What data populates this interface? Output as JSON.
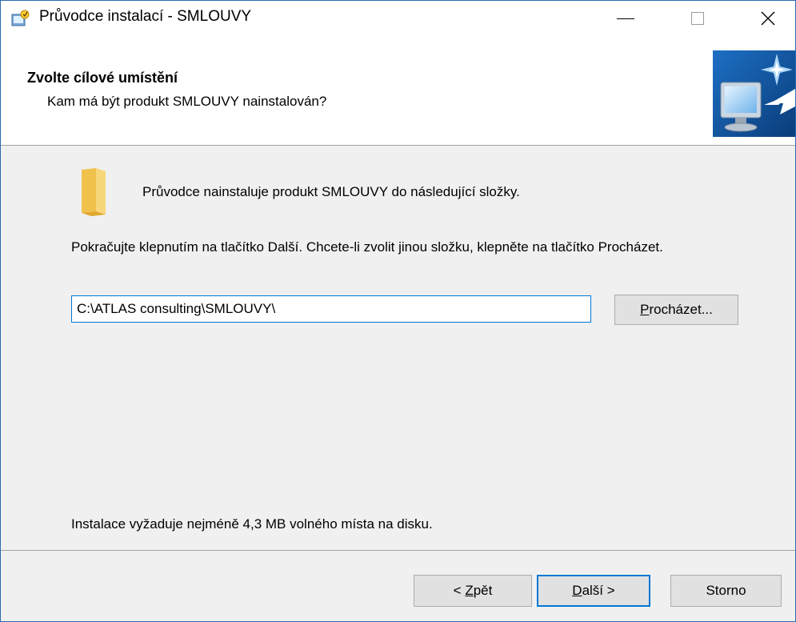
{
  "window": {
    "title": "Průvodce instalací - SMLOUVY"
  },
  "header": {
    "title": "Zvolte cílové umístění",
    "subtitle": "Kam má být produkt SMLOUVY nainstalován?"
  },
  "body": {
    "info_line": "Průvodce nainstaluje produkt SMLOUVY do následující složky.",
    "instruction": "Pokračujte klepnutím na tlačítko Další. Chcete-li zvolit jinou složku, klepněte na tlačítko Procházet.",
    "path_value": "C:\\ATLAS consulting\\SMLOUVY\\",
    "browse_label_accel": "P",
    "browse_label_rest": "rocházet...",
    "space_required": "Instalace vyžaduje nejméně 4,3 MB volného místa na disku."
  },
  "buttons": {
    "back_prefix": "< ",
    "back_accel": "Z",
    "back_rest": "pět",
    "next_accel": "D",
    "next_rest": "alší >",
    "cancel": "Storno"
  },
  "icons": {
    "app": "installer-icon",
    "minimize": "minimize-icon",
    "maximize": "maximize-icon",
    "close": "close-icon",
    "header": "computer-install-icon",
    "folder": "folder-icon"
  },
  "colors": {
    "accent": "#0078d7",
    "window_border": "#2b6cb0",
    "background": "#f0f0f0",
    "button": "#e1e1e1"
  }
}
